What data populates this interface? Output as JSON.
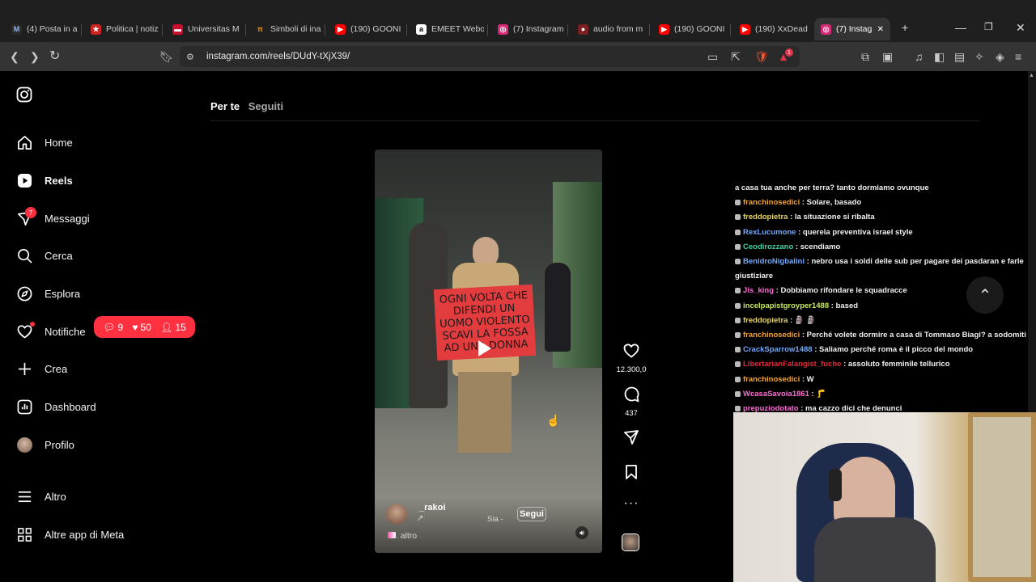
{
  "browser": {
    "tabs": [
      {
        "title": "(4) Posta in ar",
        "fav_color": "#2a2a2a",
        "fav_char": "M",
        "fav_text": "#8ab4f8"
      },
      {
        "title": "Politica | notiz",
        "fav_color": "#c22",
        "fav_char": "★",
        "fav_text": "#fff"
      },
      {
        "title": "Universitas M",
        "fav_color": "#c8102e",
        "fav_char": "▬",
        "fav_text": "#fff"
      },
      {
        "title": "Simboli di ina",
        "fav_color": "#1f1f1f",
        "fav_char": "π",
        "fav_text": "#f39c12"
      },
      {
        "title": "(190) GOONI",
        "fav_color": "#f00",
        "fav_char": "▶",
        "fav_text": "#fff"
      },
      {
        "title": "EMEET Webo",
        "fav_color": "#fff",
        "fav_char": "a",
        "fav_text": "#000"
      },
      {
        "title": "(7) Instagram",
        "fav_color": "#d62976",
        "fav_char": "◎",
        "fav_text": "#fff"
      },
      {
        "title": "audio from m",
        "fav_color": "#7a1f1f",
        "fav_char": "●",
        "fav_text": "#fff"
      },
      {
        "title": "(190) GOONI",
        "fav_color": "#f00",
        "fav_char": "▶",
        "fav_text": "#fff"
      },
      {
        "title": "(190) XxDead",
        "fav_color": "#f00",
        "fav_char": "▶",
        "fav_text": "#fff"
      },
      {
        "title": "(7) Instag",
        "fav_color": "#d62976",
        "fav_char": "◎",
        "fav_text": "#fff"
      }
    ],
    "new_tab": "+",
    "url": "instagram.com/reels/DUdY-tXjX39/",
    "brave_badge": "1"
  },
  "sidebar": {
    "items": [
      {
        "label": "Home",
        "icon": "home-icon"
      },
      {
        "label": "Reels",
        "icon": "reels-icon"
      },
      {
        "label": "Messaggi",
        "icon": "messages-icon"
      },
      {
        "label": "Cerca",
        "icon": "search-icon"
      },
      {
        "label": "Esplora",
        "icon": "explore-icon"
      },
      {
        "label": "Notifiche",
        "icon": "heart-icon"
      },
      {
        "label": "Crea",
        "icon": "plus-icon"
      },
      {
        "label": "Dashboard",
        "icon": "dashboard-icon"
      },
      {
        "label": "Profilo",
        "icon": "avatar"
      }
    ],
    "bottom": [
      {
        "label": "Altro",
        "icon": "menu-icon"
      },
      {
        "label": "Altre app di Meta",
        "icon": "meta-apps-icon"
      }
    ],
    "messages_badge": "7",
    "notif_pill": {
      "comments": "9",
      "likes": "50",
      "follows": "15"
    }
  },
  "feed_tabs": {
    "active": "Per te",
    "inactive": "Seguiti"
  },
  "reel": {
    "sign_text": "OGNI VOLTA CHE DIFENDI UN UOMO VIOLENTO SCAVI LA FOSSA AD UNA DONNA",
    "username": "_rakoi",
    "audio": "Sia -",
    "follow": "Segui",
    "more": "... altro",
    "likes": "12.300,0",
    "comments": "437"
  },
  "chat": [
    {
      "user": "",
      "color": "#f0f0f0",
      "text": "a casa tua anche per terra? tanto dormiamo ovunque"
    },
    {
      "user": "franchinosedici",
      "color": "#f2a33a",
      "text": ": Solare, basado"
    },
    {
      "user": "freddopietra",
      "color": "#e6d36c",
      "text": ": la situazione si ribalta"
    },
    {
      "user": "RexLucumone",
      "color": "#6fa8ff",
      "text": ": querela preventiva israel style"
    },
    {
      "user": "Ceodirozzano",
      "color": "#3ad6a0",
      "text": ": scendiamo"
    },
    {
      "user": "BenidroNigbalini",
      "color": "#6fa8ff",
      "text": ": nebro usa i soldi delle sub per pagare dei pasdaran e farle"
    },
    {
      "user": "",
      "color": "#f0f0f0",
      "text": "giustiziare"
    },
    {
      "user": "Jis_king",
      "color": "#ff6bd6",
      "text": ": Dobbiamo rifondare le squadracce"
    },
    {
      "user": "incelpapistgroyper1488",
      "color": "#c8e85a",
      "text": ": based"
    },
    {
      "user": "freddopietra",
      "color": "#e6d36c",
      "text": ": 🗿 🗿"
    },
    {
      "user": "franchinosedici",
      "color": "#f2a33a",
      "text": ": Perché volete dormire a casa di Tommaso Biagi? a sodomiti"
    },
    {
      "user": "CrackSparrow1488",
      "color": "#6fa8ff",
      "text": ": Saliamo perché roma è il picco del mondo"
    },
    {
      "user": "LibertarianFalangist_fuche",
      "color": "#e02b3a",
      "text": ": assoluto femminile tellurico"
    },
    {
      "user": "franchinosedici",
      "color": "#f2a33a",
      "text": ": W"
    },
    {
      "user": "WcasaSavoia1861",
      "color": "#ff6bd6",
      "text": ": 🦵"
    },
    {
      "user": "prepuziodotato",
      "color": "#ff6bd6",
      "text": ": ma cazzo dici che denunci"
    }
  ]
}
